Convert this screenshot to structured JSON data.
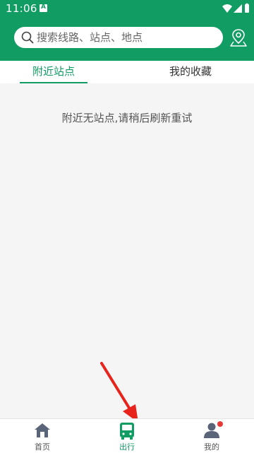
{
  "status_bar": {
    "time": "11:06"
  },
  "search": {
    "placeholder": "搜索线路、站点、地点"
  },
  "tabs": [
    {
      "label": "附近站点",
      "active": true
    },
    {
      "label": "我的收藏",
      "active": false
    }
  ],
  "main": {
    "empty_message": "附近无站点,请稍后刷新重试"
  },
  "bottom_nav": [
    {
      "label": "首页",
      "icon": "home-icon"
    },
    {
      "label": "出行",
      "icon": "bus-icon",
      "active": true
    },
    {
      "label": "我的",
      "icon": "user-icon",
      "badge": true
    }
  ],
  "colors": {
    "brand_green": "#109c62",
    "background": "#f5f5f5",
    "nav_icon_gray": "#5a6478",
    "badge_red": "#e53935",
    "annotation_red": "#e8231c"
  }
}
